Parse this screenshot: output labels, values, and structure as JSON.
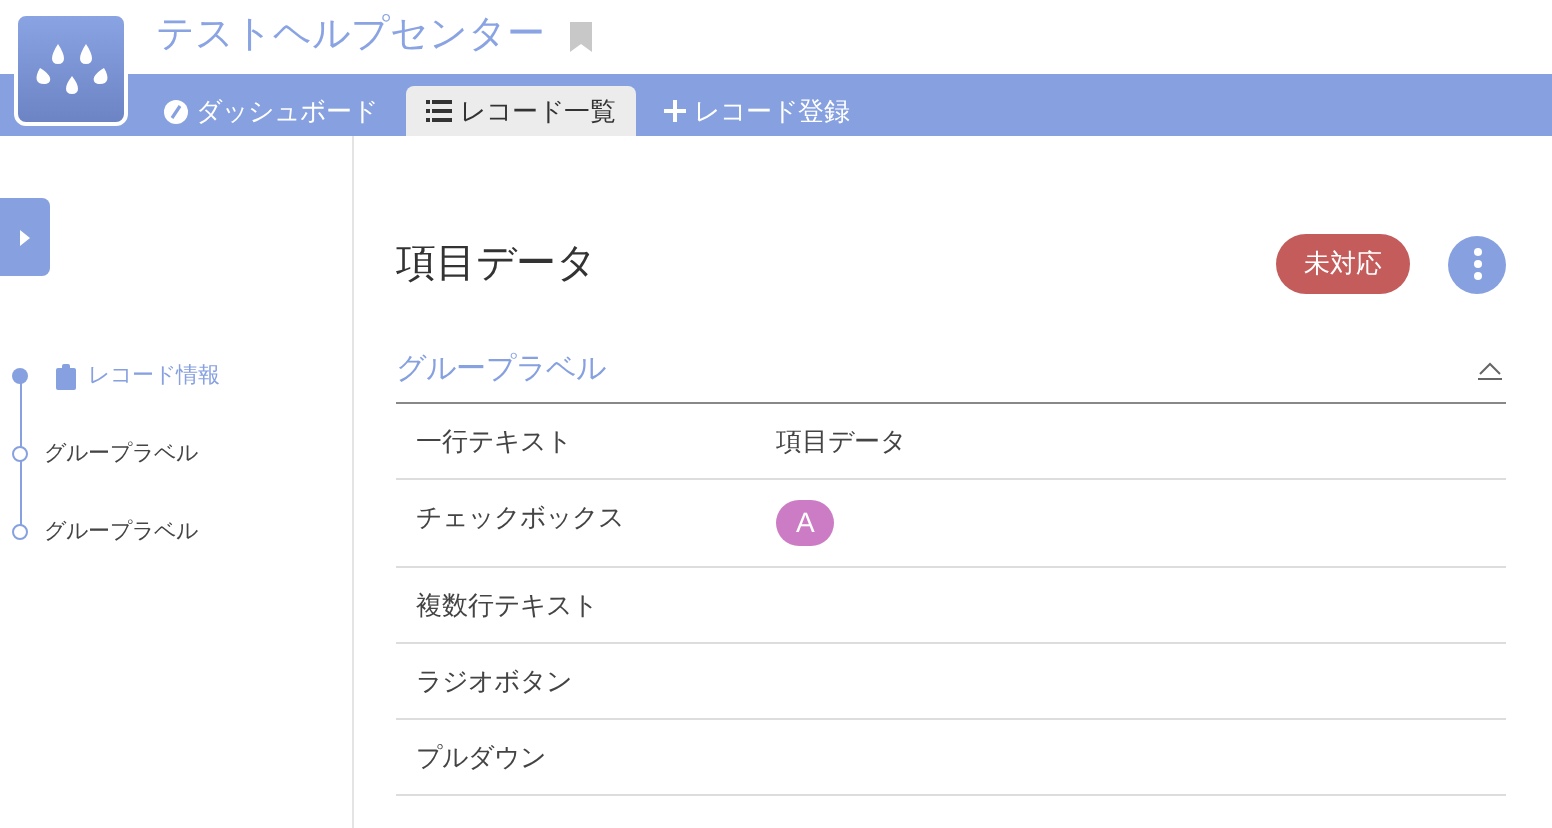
{
  "header": {
    "title": "テストヘルプセンター",
    "bookmarked": false
  },
  "nav_tabs": [
    {
      "label": "ダッシュボード",
      "kind": "gauge",
      "selected": false
    },
    {
      "label": "レコード一覧",
      "kind": "list",
      "selected": true
    },
    {
      "label": "レコード登録",
      "kind": "plus",
      "selected": false
    }
  ],
  "sidebar": {
    "items": [
      {
        "label": "レコード情報",
        "selected": true
      },
      {
        "label": "グループラベル",
        "selected": false
      },
      {
        "label": "グループラベル",
        "selected": false
      }
    ]
  },
  "record": {
    "title": "項目データ",
    "status": "未対応",
    "group": {
      "label": "グループラベル",
      "expanded": true,
      "fields": [
        {
          "label": "一行テキスト",
          "kind": "text",
          "value": "項目データ"
        },
        {
          "label": "チェックボックス",
          "kind": "tags",
          "tags": [
            {
              "label": "A",
              "color": "#cc7cc4"
            }
          ]
        },
        {
          "label": "複数行テキスト",
          "kind": "text"
        },
        {
          "label": "ラジオボタン",
          "kind": "text"
        },
        {
          "label": "プルダウン",
          "kind": "text"
        }
      ]
    }
  }
}
